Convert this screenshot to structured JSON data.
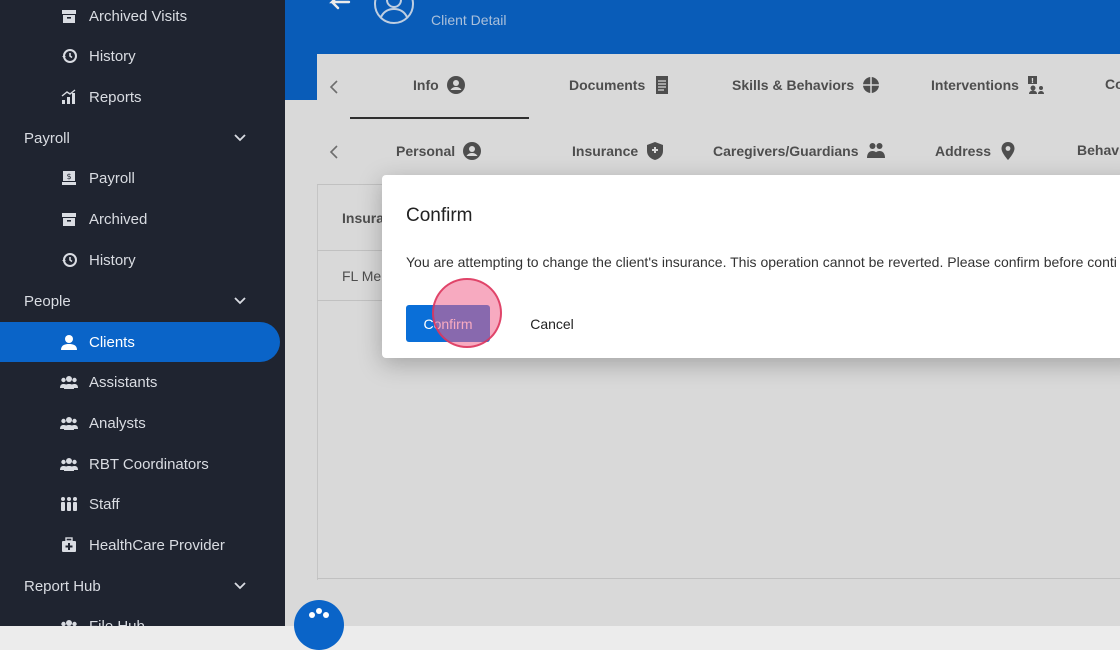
{
  "sidebar": {
    "items": [
      {
        "label": "Archived Visits",
        "icon": "archive-icon"
      },
      {
        "label": "History",
        "icon": "history-icon"
      },
      {
        "label": "Reports",
        "icon": "reports-icon"
      },
      {
        "label": "Payroll",
        "section": true
      },
      {
        "label": "Payroll",
        "icon": "payroll-icon"
      },
      {
        "label": "Archived",
        "icon": "archive-icon"
      },
      {
        "label": "History",
        "icon": "history-icon"
      },
      {
        "label": "People",
        "section": true
      },
      {
        "label": "Clients",
        "icon": "person-icon",
        "active": true
      },
      {
        "label": "Assistants",
        "icon": "group-icon"
      },
      {
        "label": "Analysts",
        "icon": "group-icon"
      },
      {
        "label": "RBT Coordinators",
        "icon": "group-icon"
      },
      {
        "label": "Staff",
        "icon": "staff-icon"
      },
      {
        "label": "HealthCare Provider",
        "icon": "medkit-icon"
      },
      {
        "label": "Report Hub",
        "section": true
      },
      {
        "label": "File Hub",
        "icon": "group-icon"
      }
    ]
  },
  "header": {
    "subtitle": "Client Detail"
  },
  "tabs_main": [
    {
      "label": "Info",
      "icon": "account-circle-icon",
      "active": true
    },
    {
      "label": "Documents",
      "icon": "document-icon"
    },
    {
      "label": "Skills & Behaviors",
      "icon": "puzzle-icon"
    },
    {
      "label": "Interventions",
      "icon": "intervention-icon"
    },
    {
      "label": "Co",
      "icon": ""
    }
  ],
  "tabs_sub": [
    {
      "label": "Personal",
      "icon": "account-circle-icon"
    },
    {
      "label": "Insurance",
      "icon": "shield-icon"
    },
    {
      "label": "Caregivers/Guardians",
      "icon": "group-icon"
    },
    {
      "label": "Address",
      "icon": "location-pin-icon"
    },
    {
      "label": "Behavi",
      "icon": ""
    }
  ],
  "table": {
    "header": "Insura",
    "row": "FL Me"
  },
  "dialog": {
    "title": "Confirm",
    "message": "You are attempting to change the client's insurance. This operation cannot be reverted. Please confirm before conti",
    "confirm_label": "Confirm",
    "cancel_label": "Cancel"
  },
  "colors": {
    "accent": "#0a64c8",
    "sidebar_bg": "#1f2430",
    "click_marker": "#f0648c"
  }
}
